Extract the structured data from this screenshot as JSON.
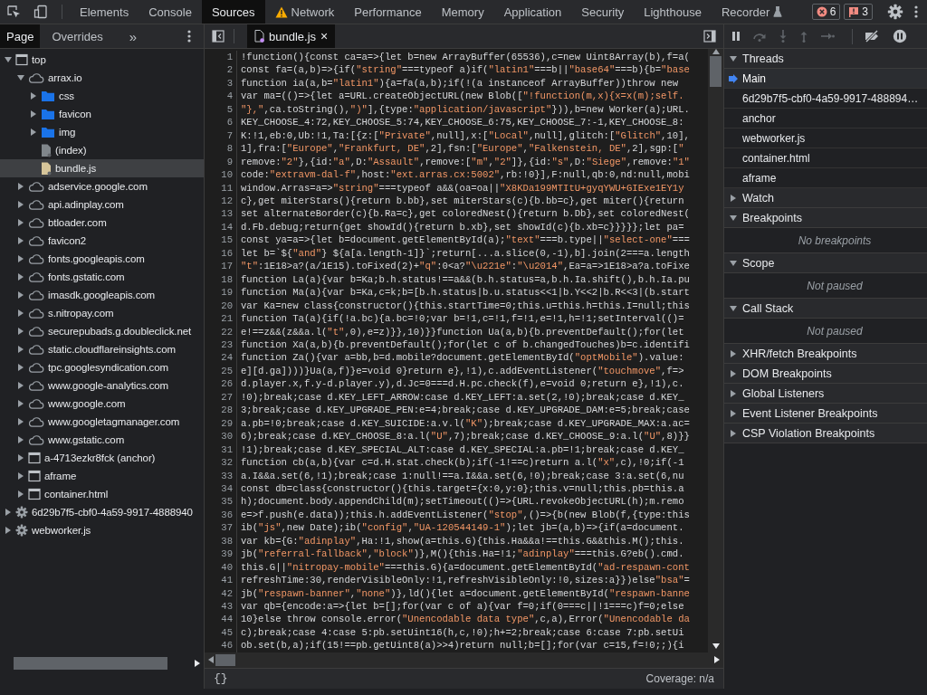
{
  "toolbar": {
    "tabs": [
      {
        "label": "Elements",
        "selected": false,
        "kind": "plain"
      },
      {
        "label": "Console",
        "selected": false,
        "kind": "plain"
      },
      {
        "label": "Sources",
        "selected": true,
        "kind": "plain"
      },
      {
        "label": "Network",
        "selected": false,
        "kind": "warning"
      },
      {
        "label": "Performance",
        "selected": false,
        "kind": "plain"
      },
      {
        "label": "Memory",
        "selected": false,
        "kind": "plain"
      },
      {
        "label": "Application",
        "selected": false,
        "kind": "plain"
      },
      {
        "label": "Security",
        "selected": false,
        "kind": "plain"
      },
      {
        "label": "Lighthouse",
        "selected": false,
        "kind": "plain"
      },
      {
        "label": "Recorder",
        "selected": false,
        "kind": "experimental"
      }
    ],
    "error_count": "6",
    "issue_count": "3"
  },
  "navigator": {
    "tabs": [
      {
        "label": "Page",
        "selected": true
      },
      {
        "label": "Overrides",
        "selected": false
      }
    ],
    "more": "»",
    "tree": [
      {
        "label": "top",
        "kind": "frame",
        "expanded": true,
        "selected": false,
        "children": [
          {
            "label": "arrax.io",
            "kind": "domain",
            "expanded": true,
            "selected": false,
            "children": [
              {
                "label": "css",
                "kind": "folder",
                "expanded": false,
                "selected": false
              },
              {
                "label": "favicon",
                "kind": "folder",
                "expanded": false,
                "selected": false
              },
              {
                "label": "img",
                "kind": "folder",
                "expanded": false,
                "selected": false
              },
              {
                "label": "(index)",
                "kind": "document",
                "selected": false
              },
              {
                "label": "bundle.js",
                "kind": "script",
                "selected": true
              }
            ]
          },
          {
            "label": "adservice.google.com",
            "kind": "domain",
            "expanded": false,
            "selected": false
          },
          {
            "label": "api.adinplay.com",
            "kind": "domain",
            "expanded": false,
            "selected": false
          },
          {
            "label": "btloader.com",
            "kind": "domain",
            "expanded": false,
            "selected": false
          },
          {
            "label": "favicon2",
            "kind": "domain",
            "expanded": false,
            "selected": false
          },
          {
            "label": "fonts.googleapis.com",
            "kind": "domain",
            "expanded": false,
            "selected": false
          },
          {
            "label": "fonts.gstatic.com",
            "kind": "domain",
            "expanded": false,
            "selected": false
          },
          {
            "label": "imasdk.googleapis.com",
            "kind": "domain",
            "expanded": false,
            "selected": false
          },
          {
            "label": "s.nitropay.com",
            "kind": "domain",
            "expanded": false,
            "selected": false
          },
          {
            "label": "securepubads.g.doubleclick.net",
            "kind": "domain",
            "expanded": false,
            "selected": false
          },
          {
            "label": "static.cloudflareinsights.com",
            "kind": "domain",
            "expanded": false,
            "selected": false
          },
          {
            "label": "tpc.googlesyndication.com",
            "kind": "domain",
            "expanded": false,
            "selected": false
          },
          {
            "label": "www.google-analytics.com",
            "kind": "domain",
            "expanded": false,
            "selected": false
          },
          {
            "label": "www.google.com",
            "kind": "domain",
            "expanded": false,
            "selected": false
          },
          {
            "label": "www.googletagmanager.com",
            "kind": "domain",
            "expanded": false,
            "selected": false
          },
          {
            "label": "www.gstatic.com",
            "kind": "domain",
            "expanded": false,
            "selected": false
          },
          {
            "label": "a-4713ezkr8fck (anchor)",
            "kind": "frame",
            "expanded": false,
            "selected": false
          },
          {
            "label": "aframe",
            "kind": "frame",
            "expanded": false,
            "selected": false
          },
          {
            "label": "container.html",
            "kind": "frame",
            "expanded": false,
            "selected": false
          }
        ]
      },
      {
        "label": "6d29b7f5-cbf0-4a59-9917-4888940",
        "kind": "worker",
        "expanded": false,
        "selected": false
      },
      {
        "label": "webworker.js",
        "kind": "worker",
        "expanded": false,
        "selected": false
      }
    ]
  },
  "editor": {
    "tabs": [
      {
        "label": "bundle.js",
        "selected": true,
        "close": "×"
      }
    ],
    "lines": [
      {
        "number": "1",
        "code": "!function(){const ca=a=>{let b=new ArrayBuffer(65536),c=new Uint8Array(b),f=a("
      },
      {
        "number": "2",
        "code": "const fa=(a,b)=>{if(\"string\"===typeof a)if(\"latin1\"===b||\"base64\"===b){b=\"base"
      },
      {
        "number": "3",
        "code": "function ia(a,b=\"latin1\"){a=fa(a,b);if(!(a instanceof ArrayBuffer))throw new"
      },
      {
        "number": "4",
        "code": "var ma=(()=>{let a=URL.createObjectURL(new Blob([\"!function(m,x){x=x(m);self."
      },
      {
        "number": "5",
        "code": "\"},\",ca.toString(),\")\"],{type:\"application/javascript\"})),b=new Worker(a);URL."
      },
      {
        "number": "6",
        "code": "KEY_CHOOSE_4:72,KEY_CHOOSE_5:74,KEY_CHOOSE_6:75,KEY_CHOOSE_7:-1,KEY_CHOOSE_8:"
      },
      {
        "number": "7",
        "code": "K:!1,eb:0,Ub:!1,Ta:[{z:[\"Private\",null],x:[\"Local\",null],glitch:[\"Glitch\",10],"
      },
      {
        "number": "8",
        "code": "1],fra:[\"Europe\",\"Frankfurt, DE\",2],fsn:[\"Europe\",\"Falkenstein, DE\",2],sgp:[\""
      },
      {
        "number": "9",
        "code": "remove:\"2\"},{id:\"a\",D:\"Assault\",remove:[\"m\",\"2\"]},{id:\"s\",D:\"Siege\",remove:\"1\""
      },
      {
        "number": "10",
        "code": "code:\"extravm-dal-f\",host:\"ext.arras.cx:5002\",rb:!0}],F:null,qb:0,nd:null,mobi"
      },
      {
        "number": "11",
        "code": "window.Arras=a=>\"string\"===typeof a&&(oa=oa||\"X8KDa199MTItU+gyqYWU+GIExe1EY1y"
      },
      {
        "number": "12",
        "code": "c},get miterStars(){return b.bb},set miterStars(c){b.bb=c},get miter(){return"
      },
      {
        "number": "13",
        "code": "set alternateBorder(c){b.Ra=c},get coloredNest(){return b.Db},set coloredNest("
      },
      {
        "number": "14",
        "code": "d.Fb.debug;return{get showId(){return b.xb},set showId(c){b.xb=c}}}}};let pa="
      },
      {
        "number": "15",
        "code": "const ya=a=>{let b=document.getElementById(a);\"text\"===b.type||\"select-one\"==="
      },
      {
        "number": "16",
        "code": "let b=`${\"and\"} ${a[a.length-1]}`;return[...a.slice(0,-1),b].join(2===a.length"
      },
      {
        "number": "17",
        "code": "\"t\":1E18>a?(a/1E15).toFixed(2)+\"q\":0<a?\"\\u221e\":\"\\u2014\",Ea=a=>1E18>a?a.toFixe"
      },
      {
        "number": "18",
        "code": "function La(a){var b=Ka;b.h.status!==a&&(b.h.status=a,b.h.Ia.shift(),b.h.Ia.pu"
      },
      {
        "number": "19",
        "code": "function Ma(a){var b=Ka,c=k;b=[b.h.status|b.u.status<<1|b.Y<<2|b.R<<3|(b.start"
      },
      {
        "number": "20",
        "code": "var Ka=new class{constructor(){this.startTime=0;this.u=this.h=this.I=null;this"
      },
      {
        "number": "21",
        "code": "function Ta(a){if(!a.bc){a.bc=!0;var b=!1,c=!1,f=!1,e=!1,h=!1;setInterval(()="
      },
      {
        "number": "22",
        "code": "e!==z&&(z&&a.l(\"t\",0),e=z)}},10)}}function Ua(a,b){b.preventDefault();for(let"
      },
      {
        "number": "23",
        "code": "function Xa(a,b){b.preventDefault();for(let c of b.changedTouches)b=c.identifi"
      },
      {
        "number": "24",
        "code": "function Za(){var a=bb,b=d.mobile?document.getElementById(\"optMobile\").value:"
      },
      {
        "number": "25",
        "code": "e][d.ga])))}Ua(a,f)}e=void 0}return e},!1),c.addEventListener(\"touchmove\",f=>"
      },
      {
        "number": "26",
        "code": "d.player.x,f.y-d.player.y),d.Jc=0===d.H.pc.check(f),e=void 0;return e},!1),c."
      },
      {
        "number": "27",
        "code": "!0);break;case d.KEY_LEFT_ARROW:case d.KEY_LEFT:a.set(2,!0);break;case d.KEY_"
      },
      {
        "number": "28",
        "code": "3;break;case d.KEY_UPGRADE_PEN:e=4;break;case d.KEY_UPGRADE_DAM:e=5;break;case"
      },
      {
        "number": "29",
        "code": "a.pb=!0;break;case d.KEY_SUICIDE:a.v.l(\"K\");break;case d.KEY_UPGRADE_MAX:a.ac="
      },
      {
        "number": "30",
        "code": "6);break;case d.KEY_CHOOSE_8:a.l(\"U\",7);break;case d.KEY_CHOOSE_9:a.l(\"U\",8)}}"
      },
      {
        "number": "31",
        "code": "!1);break;case d.KEY_SPECIAL_ALT:case d.KEY_SPECIAL:a.pb=!1;break;case d.KEY_"
      },
      {
        "number": "32",
        "code": "function cb(a,b){var c=d.H.stat.check(b);if(-1!==c)return a.l(\"x\",c),!0;if(-1"
      },
      {
        "number": "33",
        "code": "a.I&&a.set(6,!1);break;case 1:null!==a.I&&a.set(6,!0);break;case 3:a.set(6,nu"
      },
      {
        "number": "34",
        "code": "const db=class{constructor(){this.target={x:0,y:0};this.v=null;this.pb=this.a"
      },
      {
        "number": "35",
        "code": "h);document.body.appendChild(m);setTimeout(()=>{URL.revokeObjectURL(h);m.remo"
      },
      {
        "number": "36",
        "code": "e=>f.push(e.data));this.h.addEventListener(\"stop\",()=>{b(new Blob(f,{type:this"
      },
      {
        "number": "37",
        "code": "ib(\"js\",new Date);ib(\"config\",\"UA-120544149-1\");let jb=(a,b)=>{if(a=document."
      },
      {
        "number": "38",
        "code": "var kb={G:\"adinplay\",Ha:!1,show(a=this.G){this.Ha&&a!==this.G&&this.M();this."
      },
      {
        "number": "39",
        "code": "jb(\"referral-fallback\",\"block\")},M(){this.Ha=!1;\"adinplay\"===this.G?eb().cmd."
      },
      {
        "number": "40",
        "code": "this.G||\"nitropay-mobile\"===this.G){a=document.getElementById(\"ad-respawn-cont"
      },
      {
        "number": "41",
        "code": "refreshTime:30,renderVisibleOnly:!1,refreshVisibleOnly:!0,sizes:a}})else\"bsa\"="
      },
      {
        "number": "42",
        "code": "jb(\"respawn-banner\",\"none\")},ld(){let a=document.getElementById(\"respawn-banne"
      },
      {
        "number": "43",
        "code": "var qb={encode:a=>{let b=[];for(var c of a){var f=0;if(0===c||!1===c)f=0;else"
      },
      {
        "number": "44",
        "code": "10}else throw console.error(\"Unencodable data type\",c,a),Error(\"Unencodable da"
      },
      {
        "number": "45",
        "code": "c);break;case 4:case 5:pb.setUint16(h,c,!0);h+=2;break;case 6:case 7:pb.setUi"
      },
      {
        "number": "46",
        "code": "ob.set(b,a);if(15!==pb.getUint8(a)>>4)return null;b=[];for(var c=15,f=!0;;){i"
      }
    ],
    "pretty_print": "{}",
    "coverage": "Coverage: n/a"
  },
  "debugger": {
    "sections": [
      {
        "title": "Threads",
        "expanded": true,
        "items": [
          {
            "label": "Main",
            "selected": true
          },
          {
            "label": "6d29b7f5-cbf0-4a59-9917-488894…",
            "selected": false
          },
          {
            "label": "anchor",
            "selected": false
          },
          {
            "label": "webworker.js",
            "selected": false
          },
          {
            "label": "container.html",
            "selected": false
          },
          {
            "label": "aframe",
            "selected": false
          }
        ]
      },
      {
        "title": "Watch",
        "expanded": false
      },
      {
        "title": "Breakpoints",
        "expanded": true,
        "message": "No breakpoints"
      },
      {
        "title": "Scope",
        "expanded": true,
        "message": "Not paused"
      },
      {
        "title": "Call Stack",
        "expanded": true,
        "message": "Not paused"
      },
      {
        "title": "XHR/fetch Breakpoints",
        "expanded": false
      },
      {
        "title": "DOM Breakpoints",
        "expanded": false
      },
      {
        "title": "Global Listeners",
        "expanded": false
      },
      {
        "title": "Event Listener Breakpoints",
        "expanded": false
      },
      {
        "title": "CSP Violation Breakpoints",
        "expanded": false
      }
    ]
  }
}
